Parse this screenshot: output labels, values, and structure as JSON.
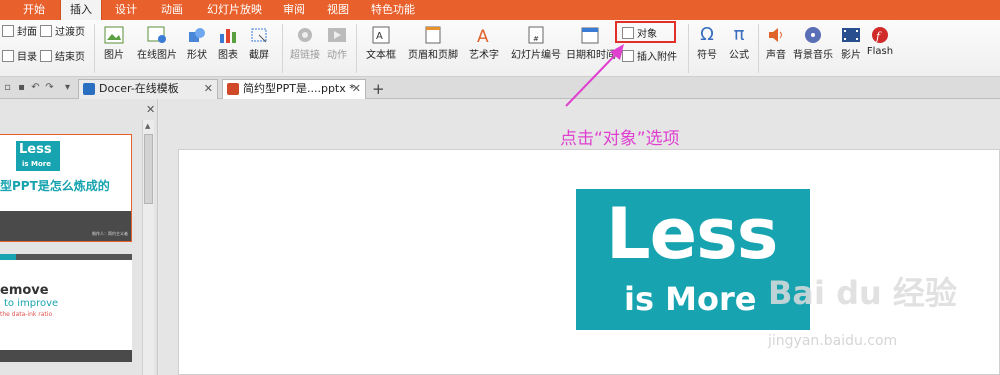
{
  "menu": {
    "tabs": [
      "开始",
      "插入",
      "设计",
      "动画",
      "幻灯片放映",
      "审阅",
      "视图",
      "特色功能"
    ],
    "active_index": 1
  },
  "ribbon": {
    "cover": "封面",
    "transition": "过渡页",
    "toc": "目录",
    "ending": "结束页",
    "picture": "图片",
    "online_picture": "在线图片",
    "shapes": "形状",
    "chart": "图表",
    "screenshot": "截屏",
    "hyperlink": "超链接",
    "action": "动作",
    "textbox": "文本框",
    "header_footer": "页眉和页脚",
    "wordart": "艺术字",
    "slide_number": "幻灯片编号",
    "datetime": "日期和时间",
    "object": "对象",
    "attachment": "插入附件",
    "symbol": "符号",
    "formula": "公式",
    "sound": "声音",
    "bg_music": "背景音乐",
    "movie": "影片",
    "flash": "Flash"
  },
  "tabs": {
    "docer": "Docer-在线模板",
    "file": "简约型PPT是....pptx *"
  },
  "thumbs": {
    "t1_less": "Less",
    "t1_more": "is More",
    "t1_title": "型PPT是怎么炼成的",
    "t1_footer": "制作人：简约主义者",
    "t2_line1": "emove",
    "t2_line2": "to improve",
    "t2_line3": "the data-ink ratio"
  },
  "slide": {
    "less": "Less",
    "more": "is More"
  },
  "annotation": "点击“对象”选项",
  "watermark": {
    "brand": "Bai du 经验",
    "url": "jingyan.baidu.com"
  },
  "colors": {
    "menu_orange": "#e8602c",
    "teal": "#17a3b0",
    "annotation_magenta": "#e040d0",
    "highlight_red": "#e0302a"
  }
}
